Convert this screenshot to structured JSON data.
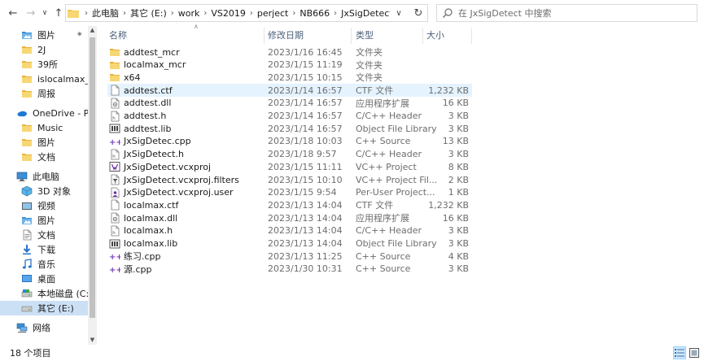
{
  "nav": {
    "back_icon": "back-arrow-icon",
    "forward_icon": "forward-arrow-icon",
    "recent_icon": "chevron-down-icon",
    "up_icon": "up-arrow-icon"
  },
  "address": {
    "crumbs": [
      "此电脑",
      "其它 (E:)",
      "work",
      "VS2019",
      "perject",
      "NB666",
      "JxSigDetect"
    ]
  },
  "search": {
    "placeholder": "在 JxSigDetect 中搜索"
  },
  "sidebar": {
    "items": [
      {
        "label": "图片",
        "icon": "pictures-icon",
        "pinned": true
      },
      {
        "label": "2J",
        "icon": "folder-icon"
      },
      {
        "label": "39所",
        "icon": "folder-icon"
      },
      {
        "label": "islocalmax_zhu",
        "icon": "folder-icon"
      },
      {
        "label": "周报",
        "icon": "folder-icon"
      },
      {
        "label": "OneDrive - Perso",
        "icon": "onedrive-icon"
      },
      {
        "label": "Music",
        "icon": "folder-icon"
      },
      {
        "label": "图片",
        "icon": "folder-icon"
      },
      {
        "label": "文档",
        "icon": "folder-icon"
      },
      {
        "label": "此电脑",
        "icon": "pc-icon"
      },
      {
        "label": "3D 对象",
        "icon": "3d-objects-icon"
      },
      {
        "label": "视频",
        "icon": "videos-icon"
      },
      {
        "label": "图片",
        "icon": "pictures-icon"
      },
      {
        "label": "文档",
        "icon": "documents-icon"
      },
      {
        "label": "下载",
        "icon": "downloads-icon"
      },
      {
        "label": "音乐",
        "icon": "music-icon"
      },
      {
        "label": "桌面",
        "icon": "desktop-icon"
      },
      {
        "label": "本地磁盘 (C:)",
        "icon": "local-disk-icon"
      },
      {
        "label": "其它 (E:)",
        "icon": "drive-icon",
        "selected": true
      },
      {
        "label": "网络",
        "icon": "network-icon"
      }
    ]
  },
  "columns": {
    "name": "名称",
    "date": "修改日期",
    "type": "类型",
    "size": "大小"
  },
  "files": [
    {
      "name": "addtest_mcr",
      "date": "2023/1/16 16:45",
      "type": "文件夹",
      "size": "",
      "icon": "folder-icon"
    },
    {
      "name": "localmax_mcr",
      "date": "2023/1/15 11:19",
      "type": "文件夹",
      "size": "",
      "icon": "folder-icon"
    },
    {
      "name": "x64",
      "date": "2023/1/15 10:15",
      "type": "文件夹",
      "size": "",
      "icon": "folder-icon"
    },
    {
      "name": "addtest.ctf",
      "date": "2023/1/14 16:57",
      "type": "CTF 文件",
      "size": "1,232 KB",
      "icon": "file-icon",
      "selected": true
    },
    {
      "name": "addtest.dll",
      "date": "2023/1/14 16:57",
      "type": "应用程序扩展",
      "size": "16 KB",
      "icon": "dll-icon"
    },
    {
      "name": "addtest.h",
      "date": "2023/1/14 16:57",
      "type": "C/C++ Header",
      "size": "3 KB",
      "icon": "header-file-icon"
    },
    {
      "name": "addtest.lib",
      "date": "2023/1/14 16:57",
      "type": "Object File Library",
      "size": "3 KB",
      "icon": "library-file-icon"
    },
    {
      "name": "JxSigDetec.cpp",
      "date": "2023/1/18 10:03",
      "type": "C++ Source",
      "size": "13 KB",
      "icon": "cpp-file-icon"
    },
    {
      "name": "JxSigDetect.h",
      "date": "2023/1/18 9:57",
      "type": "C/C++ Header",
      "size": "3 KB",
      "icon": "header-file-icon"
    },
    {
      "name": "JxSigDetect.vcxproj",
      "date": "2023/1/15 11:11",
      "type": "VC++ Project",
      "size": "8 KB",
      "icon": "vcxproj-file-icon"
    },
    {
      "name": "JxSigDetect.vcxproj.filters",
      "date": "2023/1/15 10:10",
      "type": "VC++ Project Fil...",
      "size": "2 KB",
      "icon": "filters-file-icon"
    },
    {
      "name": "JxSigDetect.vcxproj.user",
      "date": "2023/1/15 9:54",
      "type": "Per-User Project...",
      "size": "1 KB",
      "icon": "user-file-icon"
    },
    {
      "name": "localmax.ctf",
      "date": "2023/1/13 14:04",
      "type": "CTF 文件",
      "size": "1,232 KB",
      "icon": "file-icon"
    },
    {
      "name": "localmax.dll",
      "date": "2023/1/13 14:04",
      "type": "应用程序扩展",
      "size": "16 KB",
      "icon": "dll-icon"
    },
    {
      "name": "localmax.h",
      "date": "2023/1/13 14:04",
      "type": "C/C++ Header",
      "size": "3 KB",
      "icon": "header-file-icon"
    },
    {
      "name": "localmax.lib",
      "date": "2023/1/13 14:04",
      "type": "Object File Library",
      "size": "3 KB",
      "icon": "library-file-icon"
    },
    {
      "name": "练习.cpp",
      "date": "2023/1/13 11:25",
      "type": "C++ Source",
      "size": "4 KB",
      "icon": "cpp-file-icon"
    },
    {
      "name": "源.cpp",
      "date": "2023/1/30 10:31",
      "type": "C++ Source",
      "size": "3 KB",
      "icon": "cpp-file-icon"
    }
  ],
  "status": {
    "count": "18 个项目"
  },
  "colors": {
    "selected_sidebar": "#cce0f5",
    "selected_row": "#e5f3ff",
    "folder_yellow": "#f2c94c",
    "header_text": "#4c607a"
  }
}
